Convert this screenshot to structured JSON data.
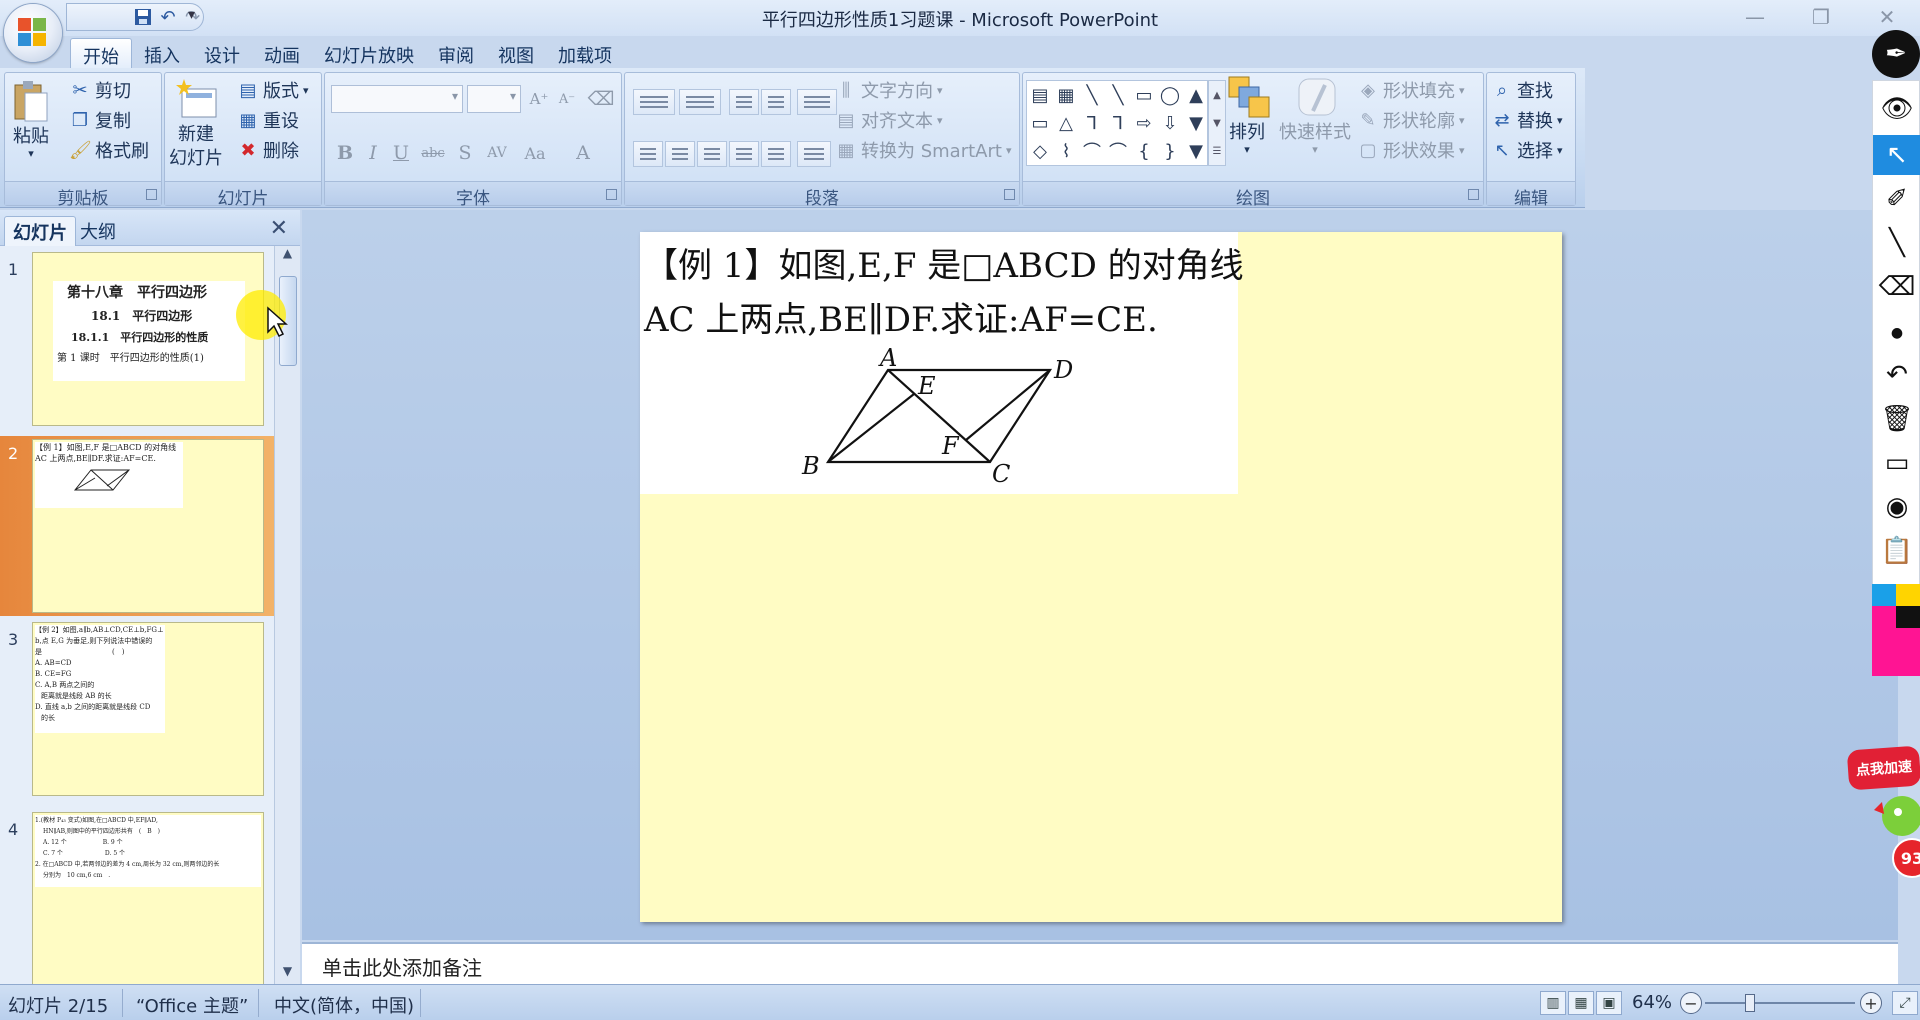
{
  "window": {
    "title": "平行四边形性质1习题课 - Microsoft PowerPoint",
    "controls": [
      "—",
      "❐",
      "✕"
    ]
  },
  "qat": {
    "icons": [
      "save-icon",
      "undo-icon",
      "redo-icon",
      "customize-icon"
    ]
  },
  "tabs": [
    {
      "label": "开始",
      "active": true
    },
    {
      "label": "插入"
    },
    {
      "label": "设计"
    },
    {
      "label": "动画"
    },
    {
      "label": "幻灯片放映"
    },
    {
      "label": "审阅"
    },
    {
      "label": "视图"
    },
    {
      "label": "加载项"
    }
  ],
  "ribbon": {
    "clipboard": {
      "label": "剪贴板",
      "paste": "粘贴",
      "cut": "剪切",
      "copy": "复制",
      "format_painter": "格式刷"
    },
    "slides": {
      "label": "幻灯片",
      "new_slide_1": "新建",
      "new_slide_2": "幻灯片",
      "layout": "版式",
      "reset": "重设",
      "delete": "删除"
    },
    "font": {
      "label": "字体",
      "buttons": [
        "B",
        "I",
        "U",
        "abc",
        "S",
        "AV",
        "Aa",
        "A"
      ],
      "grow": "A⁺",
      "shrink": "A⁻"
    },
    "paragraph": {
      "label": "段落",
      "text_direction": "文字方向",
      "align_text": "对齐文本",
      "smartart": "转换为 SmartArt"
    },
    "drawing": {
      "label": "绘图",
      "arrange": "排列",
      "quick_styles": "快速样式",
      "shape_fill": "形状填充",
      "shape_outline": "形状轮廓",
      "shape_effects": "形状效果",
      "shapes": [
        "▤",
        "▦",
        "╲",
        "╲",
        "▭",
        "◯",
        "▲",
        "▭",
        "△",
        "⅂",
        "⅂",
        "⇨",
        "⇩",
        "▼",
        "◇",
        "⌇",
        "⌒",
        "⌒",
        "{",
        "}",
        "▼"
      ]
    },
    "editing": {
      "label": "编辑",
      "find": "查找",
      "replace": "替换",
      "select": "选择"
    }
  },
  "left_pane": {
    "tab_slides": "幻灯片",
    "tab_outline": "大纲",
    "close": "✕",
    "thumbnails": [
      {
        "num": "1",
        "lines": [
          "第十八章　平行四边形",
          "18.1　平行四边形",
          "18.1.1　平行四边形的性质",
          "第 1 课时　平行四边形的性质(1)"
        ]
      },
      {
        "num": "2",
        "lines": [
          "【例 1】如图,E,F 是□ABCD 的对角线",
          "AC 上两点,BE∥DF.求证:AF=CE."
        ]
      },
      {
        "num": "3",
        "lines": [
          "【例 2】如图,a∥b,AB⊥CD,CE⊥b,FG⊥",
          "b,点 E,G 为垂足,则下列说法中错误的",
          "是　　　　　　　　　　(　)",
          "A. AB=CD",
          "B. CE=FG",
          "C. A,B 两点之间的",
          "距离就是线段 AB 的长",
          "D. 直线 a,b 之间的距离就是线段 CD",
          "的长"
        ]
      },
      {
        "num": "4",
        "lines": [
          "1.(教材 P₄₃ 变式)如图,在□ABCD 中,EF∥AD,",
          "HN∥AB,则图中的平行四边形共有　(　B　)",
          "A. 12 个　　　　　　B. 9 个",
          "C. 7 个　　　　　　　D. 5 个",
          "2. 在□ABCD 中,若两邻边的差为 4 cm,周长为 32 cm,则两邻边的长",
          "分别为　10 cm,6 cm　."
        ]
      }
    ]
  },
  "slide": {
    "line1": "【例 1】如图,E,F 是□ABCD 的对角线",
    "line2": "AC 上两点,BE∥DF.求证:AF=CE.",
    "figure_labels": {
      "A": "A",
      "B": "B",
      "C": "C",
      "D": "D",
      "E": "E",
      "F": "F"
    }
  },
  "notes": {
    "placeholder": "单击此处添加备注"
  },
  "status": {
    "slide_info": "幻灯片 2/15",
    "theme": "“Office 主题”",
    "language": "中文(简体，中国)",
    "zoom": "64%"
  },
  "overlay": {
    "speed_label": "点我加速",
    "badge": "93"
  },
  "colors": {
    "slide_bg": "#fffcc4",
    "selected_thumb": "#e6863c",
    "ribbon": "#c6d9f1",
    "accent_blue": "#1f8ce0"
  }
}
